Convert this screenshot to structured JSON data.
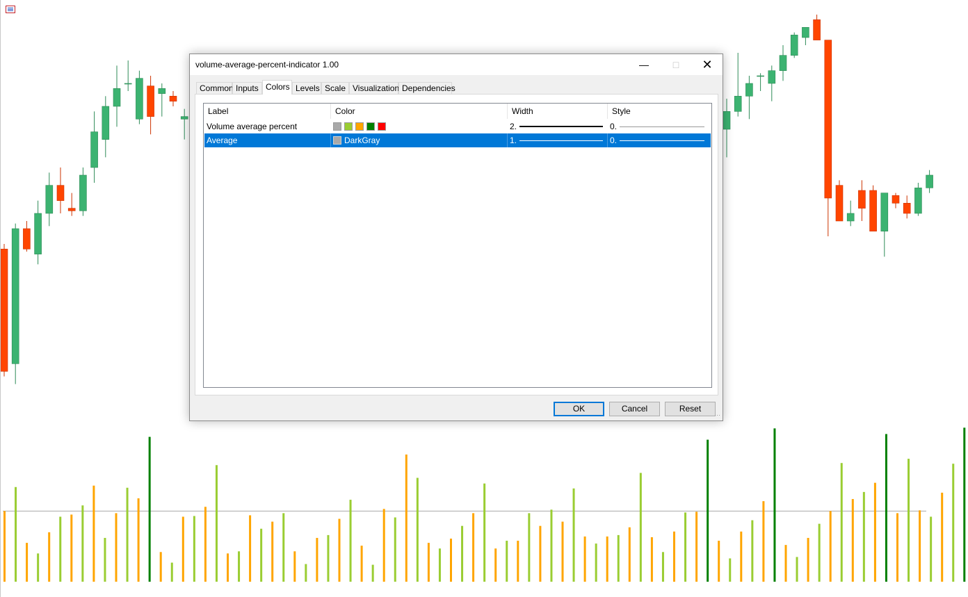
{
  "colors": {
    "bull_candle": "#3cb371",
    "bear_candle": "#ff4500",
    "volume_green_light": "#9acd32",
    "volume_orange": "#ffa500",
    "volume_green_dark": "#008000",
    "volume_red": "#ff0000",
    "average_line": "#a9a9a9",
    "selection": "#0078d7"
  },
  "chart_data": [
    {
      "type": "candlestick",
      "series": [
        {
          "name": "",
          "ohlc": [
            [
              1.09,
              1.092,
              1.04,
              1.042
            ],
            [
              1.045,
              1.1,
              1.037,
              1.098
            ],
            [
              1.098,
              1.101,
              1.089,
              1.09
            ],
            [
              1.088,
              1.109,
              1.084,
              1.104
            ],
            [
              1.104,
              1.12,
              1.099,
              1.115
            ],
            [
              1.115,
              1.122,
              1.104,
              1.109
            ],
            [
              1.106,
              1.112,
              1.103,
              1.105
            ],
            [
              1.105,
              1.122,
              1.103,
              1.119
            ],
            [
              1.122,
              1.144,
              1.116,
              1.136
            ],
            [
              1.133,
              1.15,
              1.126,
              1.146
            ],
            [
              1.146,
              1.162,
              1.138,
              1.153
            ],
            [
              1.155,
              1.164,
              1.152,
              1.155
            ],
            [
              1.141,
              1.16,
              1.139,
              1.157
            ],
            [
              1.154,
              1.158,
              1.135,
              1.142
            ],
            [
              1.151,
              1.155,
              1.142,
              1.153
            ],
            [
              1.15,
              1.152,
              1.146,
              1.148
            ],
            [
              1.141,
              1.145,
              1.133,
              1.142
            ],
            [
              1.145,
              1.16,
              1.143,
              1.158
            ],
            [
              1.16,
              1.162,
              1.152,
              1.157
            ],
            [
              1.16,
              1.165,
              1.149,
              1.152
            ],
            [
              1.152,
              1.158,
              1.149,
              1.155
            ],
            [
              1.152,
              1.155,
              1.132,
              1.134
            ],
            [
              1.137,
              1.149,
              1.126,
              1.144
            ],
            [
              1.144,
              1.167,
              1.142,
              1.15
            ],
            [
              1.15,
              1.158,
              1.141,
              1.155
            ],
            [
              1.158,
              1.159,
              1.152,
              1.158
            ],
            [
              1.155,
              1.162,
              1.148,
              1.16
            ],
            [
              1.16,
              1.17,
              1.156,
              1.166
            ],
            [
              1.166,
              1.175,
              1.165,
              1.174
            ],
            [
              1.173,
              1.177,
              1.17,
              1.177
            ],
            [
              1.18,
              1.182,
              1.172,
              1.172
            ],
            [
              1.172,
              1.171,
              1.095,
              1.11
            ],
            [
              1.115,
              1.117,
              1.101,
              1.101
            ],
            [
              1.101,
              1.109,
              1.099,
              1.104
            ],
            [
              1.113,
              1.117,
              1.101,
              1.106
            ],
            [
              1.113,
              1.115,
              1.097,
              1.097
            ],
            [
              1.097,
              1.111,
              1.087,
              1.112
            ],
            [
              1.111,
              1.112,
              1.106,
              1.108
            ],
            [
              1.108,
              1.111,
              1.102,
              1.104
            ],
            [
              1.104,
              1.116,
              1.103,
              1.114
            ],
            [
              1.114,
              1.121,
              1.112,
              1.119
            ]
          ]
        }
      ]
    },
    {
      "type": "bar",
      "series": [
        {
          "name": "Volume average percent",
          "values": [
            100,
            134,
            55,
            40,
            70,
            92,
            95,
            108,
            136,
            62,
            97,
            133,
            118,
            205,
            42,
            27,
            92,
            93,
            106,
            165,
            40,
            43,
            94,
            75,
            85,
            97,
            43,
            25,
            62,
            66,
            89,
            116,
            51,
            24,
            103,
            91,
            180,
            147,
            55,
            47,
            61,
            79,
            97,
            139,
            47,
            58,
            58,
            97,
            79,
            102,
            85,
            132,
            64,
            54,
            64,
            66,
            77,
            154,
            63,
            42,
            71,
            98,
            99,
            201,
            58,
            33,
            71,
            87,
            114,
            217,
            52,
            35,
            62,
            82,
            100,
            168,
            117,
            127,
            140,
            209,
            97,
            174,
            101,
            92,
            126,
            167,
            218,
            97,
            153,
            148,
            182,
            224,
            73,
            38,
            76,
            98
          ]
        },
        {
          "name": "Average",
          "values": [
            100
          ]
        }
      ]
    }
  ],
  "dialog": {
    "title": "volume-average-percent-indicator 1.00",
    "tabs": [
      "Common",
      "Inputs",
      "Colors",
      "Levels",
      "Scale",
      "Visualization",
      "Dependencies"
    ],
    "active_tab": "Colors",
    "columns": [
      "Label",
      "Color",
      "Width",
      "Style"
    ],
    "rows": [
      {
        "label": "Volume average percent",
        "swatches": [
          "#a9a9a9",
          "#9acd32",
          "#ffa500",
          "#008000",
          "#ff0000"
        ],
        "color_name": "",
        "width": "2.",
        "style": "0.",
        "selected": false
      },
      {
        "label": "Average",
        "swatches": [
          "#a9a9a9"
        ],
        "color_name": "DarkGray",
        "width": "1.",
        "style": "0.",
        "selected": true
      }
    ],
    "buttons": {
      "ok": "OK",
      "cancel": "Cancel",
      "reset": "Reset"
    }
  }
}
